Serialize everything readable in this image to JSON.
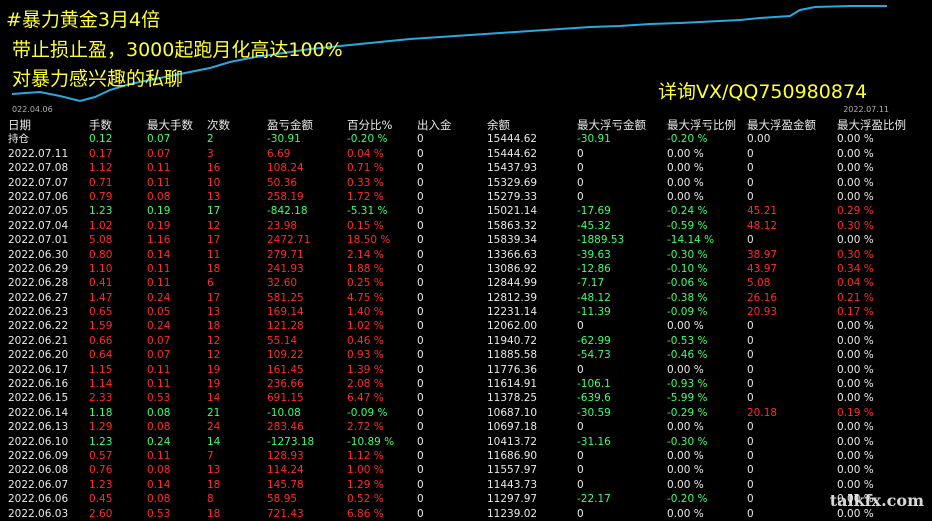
{
  "ad": {
    "line1": "#暴力黄金3月4倍",
    "line2": "带止损止盈，3000起跑月化高达100%",
    "line3": "对暴力感兴趣的私聊",
    "contact": "详询VX/QQ750980874"
  },
  "chart": {
    "start_label": "022.04.06",
    "end_label": "2022.07.11",
    "line_color": "#29a8e0"
  },
  "watermark": "talkfx.com",
  "headers": [
    "日期",
    "手数",
    "最大手数",
    "次数",
    "盈亏金额",
    "百分比%",
    "出入金",
    "余额",
    "最大浮亏金额",
    "最大浮亏比例",
    "最大浮盈金额",
    "最大浮盈比例"
  ],
  "holding_row": [
    "持仓",
    "0.12",
    "0.07",
    "2",
    "-30.91",
    "-0.20 %",
    "0",
    "15444.62",
    "-30.91",
    "-0.20 %",
    "0.00",
    "0.00 %"
  ],
  "rows": [
    [
      "2022.07.11",
      "0.17",
      "0.07",
      "3",
      "6.69",
      "0.04 %",
      "0",
      "15444.62",
      "0",
      "0.00 %",
      "0",
      "0.00 %"
    ],
    [
      "2022.07.08",
      "1.12",
      "0.11",
      "16",
      "108.24",
      "0.71 %",
      "0",
      "15437.93",
      "0",
      "0.00 %",
      "0",
      "0.00 %"
    ],
    [
      "2022.07.07",
      "0.71",
      "0.11",
      "10",
      "50.36",
      "0.33 %",
      "0",
      "15329.69",
      "0",
      "0.00 %",
      "0",
      "0.00 %"
    ],
    [
      "2022.07.06",
      "0.79",
      "0.08",
      "13",
      "258.19",
      "1.72 %",
      "0",
      "15279.33",
      "0",
      "0.00 %",
      "0",
      "0.00 %"
    ],
    [
      "2022.07.05",
      "1.23",
      "0.19",
      "17",
      "-842.18",
      "-5.31 %",
      "0",
      "15021.14",
      "-17.69",
      "-0.24 %",
      "45.21",
      "0.29 %"
    ],
    [
      "2022.07.04",
      "1.02",
      "0.19",
      "12",
      "23.98",
      "0.15 %",
      "0",
      "15863.32",
      "-45.32",
      "-0.59 %",
      "48.12",
      "0.30 %"
    ],
    [
      "2022.07.01",
      "5.08",
      "1.16",
      "17",
      "2472.71",
      "18.50 %",
      "0",
      "15839.34",
      "-1889.53",
      "-14.14 %",
      "0",
      "0.00 %"
    ],
    [
      "2022.06.30",
      "0.80",
      "0.14",
      "11",
      "279.71",
      "2.14 %",
      "0",
      "13366.63",
      "-39.63",
      "-0.30 %",
      "38.97",
      "0.30 %"
    ],
    [
      "2022.06.29",
      "1.10",
      "0.11",
      "18",
      "241.93",
      "1.88 %",
      "0",
      "13086.92",
      "-12.86",
      "-0.10 %",
      "43.97",
      "0.34 %"
    ],
    [
      "2022.06.28",
      "0.41",
      "0.11",
      "6",
      "32.60",
      "0.25 %",
      "0",
      "12844.99",
      "-7.17",
      "-0.06 %",
      "5.08",
      "0.04 %"
    ],
    [
      "2022.06.27",
      "1.47",
      "0.24",
      "17",
      "581.25",
      "4.75 %",
      "0",
      "12812.39",
      "-48.12",
      "-0.38 %",
      "26.16",
      "0.21 %"
    ],
    [
      "2022.06.23",
      "0.65",
      "0.05",
      "13",
      "169.14",
      "1.40 %",
      "0",
      "12231.14",
      "-11.39",
      "-0.09 %",
      "20.93",
      "0.17 %"
    ],
    [
      "2022.06.22",
      "1.59",
      "0.24",
      "18",
      "121.28",
      "1.02 %",
      "0",
      "12062.00",
      "0",
      "0.00 %",
      "0",
      "0.00 %"
    ],
    [
      "2022.06.21",
      "0.66",
      "0.07",
      "12",
      "55.14",
      "0.46 %",
      "0",
      "11940.72",
      "-62.99",
      "-0.53 %",
      "0",
      "0.00 %"
    ],
    [
      "2022.06.20",
      "0.64",
      "0.07",
      "12",
      "109.22",
      "0.93 %",
      "0",
      "11885.58",
      "-54.73",
      "-0.46 %",
      "0",
      "0.00 %"
    ],
    [
      "2022.06.17",
      "1.15",
      "0.11",
      "19",
      "161.45",
      "1.39 %",
      "0",
      "11776.36",
      "0",
      "0.00 %",
      "0",
      "0.00 %"
    ],
    [
      "2022.06.16",
      "1.14",
      "0.11",
      "19",
      "236.66",
      "2.08 %",
      "0",
      "11614.91",
      "-106.1",
      "-0.93 %",
      "0",
      "0.00 %"
    ],
    [
      "2022.06.15",
      "2.33",
      "0.53",
      "14",
      "691.15",
      "6.47 %",
      "0",
      "11378.25",
      "-639.6",
      "-5.99 %",
      "0",
      "0.00 %"
    ],
    [
      "2022.06.14",
      "1.18",
      "0.08",
      "21",
      "-10.08",
      "-0.09 %",
      "0",
      "10687.10",
      "-30.59",
      "-0.29 %",
      "20.18",
      "0.19 %"
    ],
    [
      "2022.06.13",
      "1.29",
      "0.08",
      "24",
      "283.46",
      "2.72 %",
      "0",
      "10697.18",
      "0",
      "0.00 %",
      "0",
      "0.00 %"
    ],
    [
      "2022.06.10",
      "1.23",
      "0.24",
      "14",
      "-1273.18",
      "-10.89 %",
      "0",
      "10413.72",
      "-31.16",
      "-0.30 %",
      "0",
      "0.00 %"
    ],
    [
      "2022.06.09",
      "0.57",
      "0.11",
      "7",
      "128.93",
      "1.12 %",
      "0",
      "11686.90",
      "0",
      "0.00 %",
      "0",
      "0.00 %"
    ],
    [
      "2022.06.08",
      "0.76",
      "0.08",
      "13",
      "114.24",
      "1.00 %",
      "0",
      "11557.97",
      "0",
      "0.00 %",
      "0",
      "0.00 %"
    ],
    [
      "2022.06.07",
      "1.23",
      "0.14",
      "18",
      "145.78",
      "1.29 %",
      "0",
      "11443.73",
      "0",
      "0.00 %",
      "0",
      "0.00 %"
    ],
    [
      "2022.06.06",
      "0.45",
      "0.08",
      "8",
      "58.95",
      "0.52 %",
      "0",
      "11297.97",
      "-22.17",
      "-0.20 %",
      "0",
      "0.00 %"
    ],
    [
      "2022.06.03",
      "2.60",
      "0.53",
      "18",
      "721.43",
      "6.86 %",
      "0",
      "11239.02",
      "0",
      "0.00 %",
      "0",
      "0.00 %"
    ]
  ]
}
